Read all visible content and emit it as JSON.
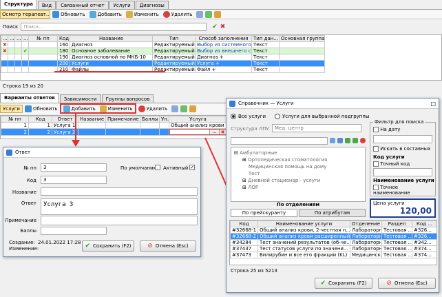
{
  "top": {
    "tabs": [
      "Структура",
      "Вид",
      "Связанный отчет",
      "Услуги",
      "Диагнозы"
    ],
    "subtab": "Осмотр терапевт...",
    "toolbar": {
      "refresh": "Обновить",
      "add": "Добавить",
      "edit": "Изменить",
      "delete": "Удалить"
    },
    "search": {
      "label": "Поиск",
      "placeholder": "Поиск..."
    },
    "columns": [
      "...",
      "...",
      "...",
      "...",
      "№ пп",
      "Код",
      "Название",
      "Тип",
      "Способ заполнения",
      "Тип дан...",
      "Основная группа"
    ],
    "rows": [
      {
        "mark": "✖",
        "check": "",
        "num": "",
        "code": "160",
        "name": "Диагноз",
        "type": "Редактируемый",
        "fill": "Выбор из системного сп...",
        "dtype": "Текст",
        "group": ""
      },
      {
        "mark": "✖",
        "check": "✔",
        "num": "",
        "code": "180",
        "name": "Основное заболевание",
        "type": "Редактируемый",
        "fill": "Выбор из внешнего спр...",
        "dtype": "Текст",
        "group": ""
      },
      {
        "mark": "",
        "check": "",
        "num": "",
        "code": "190",
        "name": "Диагноз основной по МКБ-10",
        "type": "Редактируемый",
        "fill": "Диагноз +",
        "dtype": "Текст",
        "group": ""
      },
      {
        "mark": "",
        "check": "",
        "num": "",
        "code": "200",
        "name": "Услуги",
        "type": "Редактируемый",
        "fill": "Услуга +",
        "dtype": "Текст",
        "group": ""
      },
      {
        "mark": "",
        "check": "",
        "num": "",
        "code": "210",
        "name": "Файлы",
        "type": "Редактируемый",
        "fill": "Файл +",
        "dtype": "Текст",
        "group": ""
      }
    ],
    "status": "Строка 19 из 20"
  },
  "mid": {
    "tabs": [
      "Варианты ответов",
      "Зависимости",
      "Группы вопросов"
    ],
    "toolbar": {
      "services": "Услуги",
      "refresh": "Обновить",
      "add": "Добавить",
      "edit": "Изменить",
      "delete": "Удалить"
    },
    "columns": [
      "№ пп",
      "Код",
      "Ответ",
      "Название",
      "Примечание",
      "Баллы",
      "Ун.",
      "Услуга"
    ],
    "rows": [
      {
        "num": "1",
        "code": "1",
        "answer": "Услуга 1",
        "service": "Общий анализ крови"
      },
      {
        "num": "2",
        "code": "2",
        "answer": "Услуга 2",
        "service": ""
      }
    ]
  },
  "answer": {
    "title": "Ответ",
    "num_label": "№ пп",
    "num_value": "3",
    "default_label": "По умолчанию",
    "active_label": "Активный",
    "code_label": "Код",
    "code_value": "3",
    "name_label": "Название",
    "answer_label": "Ответ",
    "answer_value": "Услуга 3",
    "note_label": "Примечание",
    "score_label": "Баллы",
    "created_label": "Создание:",
    "created_value": "24.01.2022 17:28",
    "changed_label": "Изменение:",
    "save": "Сохранить (F2)",
    "cancel": "Отмена (Esc)"
  },
  "ref": {
    "title": "Справочник — Услуги",
    "radio_all": "Все услуги",
    "radio_sub": "Услуги для выбранной подгруппы",
    "structure_label": "Структура ЛПУ",
    "structure_value": "Мед. центр",
    "tree": [
      "Амбулаторные",
      "Ортопедическая стоматология",
      "Медицинская помощь на дому",
      "Тест",
      "Дневной стационар - услуги",
      "ЛОР"
    ],
    "by_dept": "По отделениям",
    "tab_price": "По прейскуранту",
    "tab_attr": "По атрибутам",
    "filter_title": "Фильтр для поиска",
    "on_date": "На дату",
    "search_in": "Искать в составных",
    "code_title": "Код услуги",
    "exact_code": "Точный код",
    "name_title": "Наименование услуги",
    "exact_name": "Точное наименование",
    "price_label": "Цена услуги",
    "price_value": "120,00",
    "columns": [
      "Код",
      "Наименование услуги",
      "Отделение",
      "Раздел",
      "Код ..."
    ],
    "rows": [
      {
        "code": "#32668-1",
        "name": "Общий анализ крови, 2-честная п...",
        "dept": "Лабораторн...",
        "section": "Тестовая ...",
        "extra": "#326..."
      },
      {
        "code": "#32668-2",
        "name": "Общий анализ крови расширенный",
        "dept": "Лабораторн...",
        "section": "Тестовая ...",
        "extra": "#326..."
      },
      {
        "code": "#34284",
        "name": "Тест значений результатов (об-че...",
        "dept": "Лабораторн...",
        "section": "Тестовая ...",
        "extra": "#342..."
      },
      {
        "code": "#37437",
        "name": "Тест статусов услуги по значени...",
        "dept": "Лабораторн...",
        "section": "Тестовая ...",
        "extra": "#374..."
      },
      {
        "code": "#37473",
        "name": "Билирубин и все его фракции (KL)",
        "dept": "Медицинск...",
        "section": "Тестовая ...",
        "extra": "#374..."
      }
    ],
    "status": "Строка 25 из 5213",
    "save": "Сохранить (F2)",
    "cancel": "Отмена (Esc)"
  },
  "colors": {
    "accent": "#3391ff",
    "green_row": "#d9f7d2",
    "red": "#e03030"
  }
}
